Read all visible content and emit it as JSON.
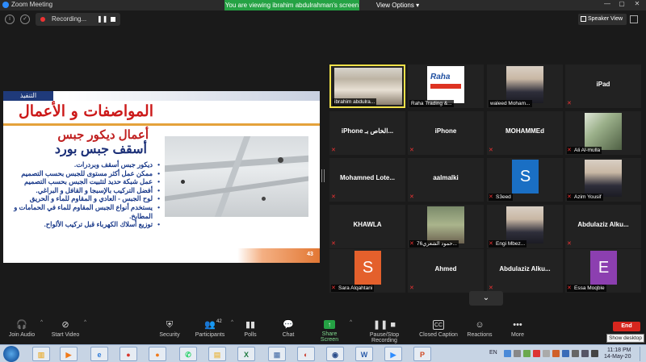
{
  "window": {
    "title": "Zoom Meeting"
  },
  "banner": {
    "viewing": "You are viewing ibrahim abdulrahman's screen",
    "view_options": "View Options"
  },
  "topbar": {
    "recording": "Recording...",
    "speaker_view": "Speaker View"
  },
  "slide": {
    "section_tag": "التنفيذ",
    "title": "المواصفات و الأعمال",
    "subtitle_1": "أعمال ديكور جبس",
    "subtitle_2": "أسقف جبس بورد",
    "bullets": [
      "ديكور جبس أسقف وبردرات.",
      "ممكن عمل أكثر مستوى للجبس بحسب التصميم",
      "عمل شبكة حديد لتثبيت الجبس بحسب التصميم",
      "أفضل التركيب بالإسبجا و القافل و البراغي.",
      "لوح الجبس - العادي و المقاوم للماء و الحريق",
      "يستخدم أنواع الجبس المقاوم للماء في الحمامات و المطابخ.",
      "توزيع أسلاك الكهرباء قبل تركيب الألواح."
    ],
    "page_number": "43"
  },
  "participants": [
    {
      "label": "ibrahim abdulra...",
      "kind": "video",
      "active": true,
      "muted": false
    },
    {
      "label": "Raha Trading &...",
      "kind": "video",
      "muted": false
    },
    {
      "label": "waleed Moham...",
      "kind": "video",
      "muted": false
    },
    {
      "label": "iPad",
      "kind": "name",
      "muted": true
    },
    {
      "label": "iPhone الخاص بـ...",
      "kind": "name",
      "muted": true
    },
    {
      "label": "iPhone",
      "kind": "name",
      "muted": true
    },
    {
      "label": "MOHAMMEd",
      "kind": "name",
      "muted": true
    },
    {
      "label": "Ali Al-mulla",
      "kind": "video",
      "muted": true
    },
    {
      "label": "Mohamned Lote...",
      "kind": "name",
      "muted": true
    },
    {
      "label": "aalmalki",
      "kind": "name",
      "muted": true
    },
    {
      "label": "S3eed",
      "kind": "avatar",
      "initial": "S",
      "color": "#1a6fc4",
      "muted": true
    },
    {
      "label": "Azim Yousif",
      "kind": "video",
      "muted": true
    },
    {
      "label": "KHAWLA",
      "kind": "name",
      "muted": true
    },
    {
      "label": "76حمود الشعري...",
      "kind": "video",
      "muted": true
    },
    {
      "label": "Engi Mbez...",
      "kind": "video",
      "muted": true
    },
    {
      "label": "Abdulaziz Alku...",
      "kind": "name",
      "muted": true
    },
    {
      "label": "Sara Alqahtani",
      "kind": "avatar",
      "initial": "S",
      "color": "#e4602c",
      "muted": true
    },
    {
      "label": "Ahmed",
      "kind": "name",
      "muted": true
    },
    {
      "label": "Abdulaziz Alku...",
      "kind": "name",
      "muted": true
    },
    {
      "label": "Essa Moqble",
      "kind": "avatar",
      "initial": "E",
      "color": "#8c3fb0",
      "muted": true
    }
  ],
  "toolbar": {
    "join_audio": "Join Audio",
    "start_video": "Start Video",
    "security": "Security",
    "participants": "Participants",
    "participants_count": "42",
    "polls": "Polls",
    "chat": "Chat",
    "share_screen": "Share Screen",
    "pause_stop_recording": "Pause/Stop Recording",
    "closed_caption": "Closed Caption",
    "cc_badge": "CC",
    "reactions": "Reactions",
    "more": "More",
    "end": "End",
    "tooltip": "Show desktop"
  },
  "taskbar": {
    "apps": [
      {
        "name": "explorer-icon",
        "glyph": "▥",
        "color": "#e8b54a"
      },
      {
        "name": "media-player-icon",
        "glyph": "▶",
        "color": "#f07a1a"
      },
      {
        "name": "internet-explorer-icon",
        "glyph": "e",
        "color": "#2e7bd8"
      },
      {
        "name": "chrome-icon",
        "glyph": "●",
        "color": "#d8382e"
      },
      {
        "name": "firefox-icon",
        "glyph": "●",
        "color": "#f07a1a"
      },
      {
        "name": "whatsapp-icon",
        "glyph": "✆",
        "color": "#25d366"
      },
      {
        "name": "folder-icon",
        "glyph": "▤",
        "color": "#e8c060"
      },
      {
        "name": "excel-icon",
        "glyph": "X",
        "color": "#1e7a40"
      },
      {
        "name": "notepad-icon",
        "glyph": "▦",
        "color": "#6a8ab8"
      },
      {
        "name": "app-red-icon",
        "glyph": "◐",
        "color": "#c83a2a"
      },
      {
        "name": "app-blue-icon",
        "glyph": "◉",
        "color": "#2a4c8a"
      },
      {
        "name": "word-icon",
        "glyph": "W",
        "color": "#2b5caa"
      },
      {
        "name": "zoom-icon",
        "glyph": "▶",
        "color": "#2d8cff"
      },
      {
        "name": "powerpoint-icon",
        "glyph": "P",
        "color": "#d04a23"
      }
    ],
    "language": "EN",
    "time": "11:18 PM",
    "date": "14-May-20"
  }
}
